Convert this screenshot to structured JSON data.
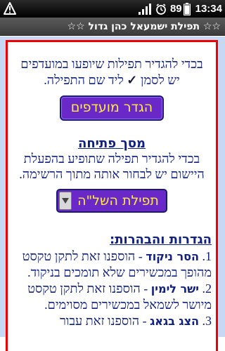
{
  "status_bar": {
    "battery_percent": "89",
    "time": "13:34",
    "icons": [
      "warning-icon",
      "signal-icon",
      "alarm-icon",
      "battery-icon"
    ]
  },
  "title_bar": {
    "title": "☆☆ תפילת ישמעאל כהן גדול ☆☆"
  },
  "favorites": {
    "text_line1": "בכדי להגדיר תפילות שיופעו במועדפים",
    "text_line2_before": "יש לסמן",
    "check_mark": "✓",
    "text_line2_after": "ליד שם התפילה.",
    "button_label": "הגדר מועדפים"
  },
  "opening_screen": {
    "heading": "מסך פתיחה",
    "text": "בכדי להגדיר תפילה שתופיע בהפעלת היישום יש לבחור אותה מתוך הרשימה.",
    "selected_option": "תפילת השל\"ה"
  },
  "settings": {
    "heading": "הגדרות והבהרות:",
    "items": [
      {
        "num": "1.",
        "term": "הסר ניקוד",
        "text": " - הוספנו זאת לתקן טקסט מהופך במכשירים שלא תומכים בניקוד."
      },
      {
        "num": "2.",
        "term": "ישר לימין",
        "text": " - הוספנו זאת לתקן טקסט מיושר לשמאל במכשירים מסוימים."
      },
      {
        "num": "3.",
        "term": "הצג בגאג",
        "text": " - הוספנו זאת עבור"
      }
    ]
  },
  "colors": {
    "frame_border": "#ee0000",
    "content_background": "#c6d8f4",
    "text": "#102080",
    "button_background": "#6a28c8",
    "button_text": "#ffeb3b"
  }
}
